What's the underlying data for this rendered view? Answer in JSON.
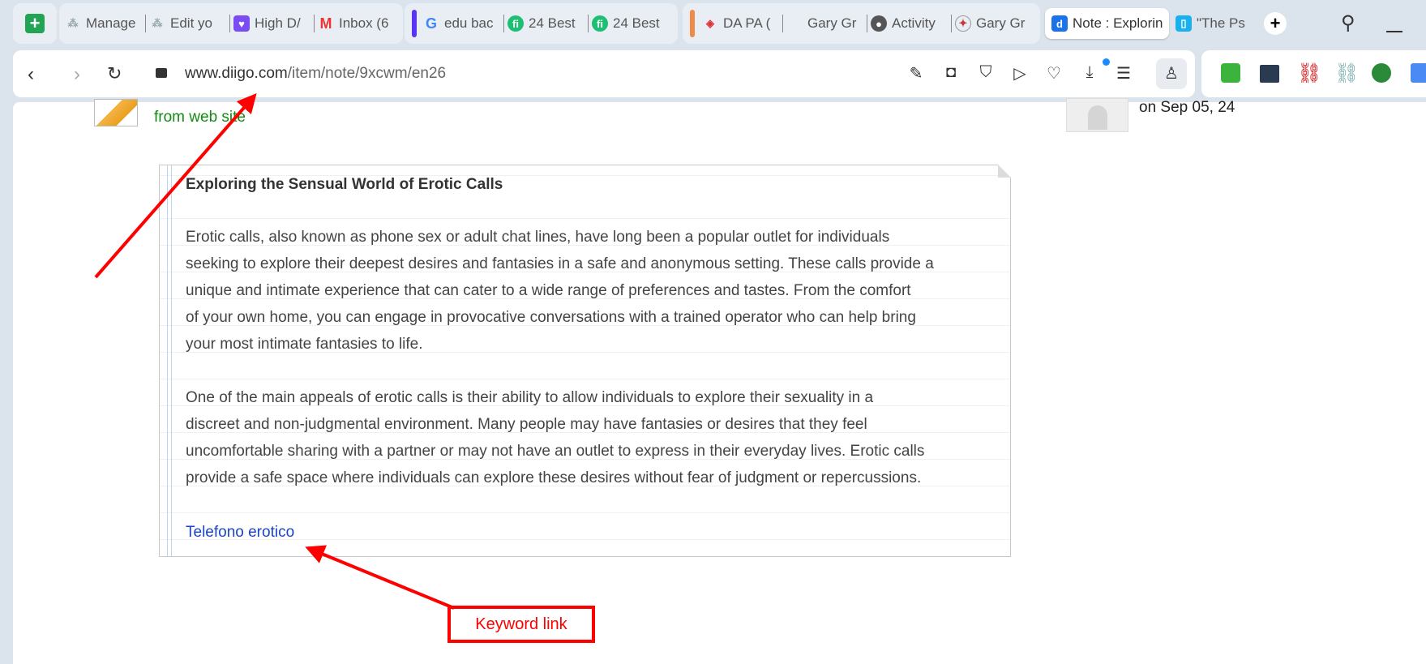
{
  "tabs": [
    {
      "label": "Manage",
      "icon": "network-icon"
    },
    {
      "label": "Edit yo",
      "icon": "network-icon"
    },
    {
      "label": "High D/",
      "icon": "heart-chat-icon"
    },
    {
      "label": "Inbox (6",
      "icon": "gmail-icon"
    },
    {
      "label": "edu bac",
      "icon": "google-icon"
    },
    {
      "label": "24 Best",
      "icon": "fiverr-icon"
    },
    {
      "label": "24 Best",
      "icon": "fiverr-icon"
    },
    {
      "label": "DA PA (",
      "icon": "diamond-icon"
    },
    {
      "label": "Gary Gr",
      "icon": "blank-icon"
    },
    {
      "label": "Activity",
      "icon": "globe-icon"
    },
    {
      "label": "Gary Gr",
      "icon": "seal-icon"
    },
    {
      "label": "Note : Explorin",
      "icon": "diigo-icon"
    },
    {
      "label": "\"The Ps",
      "icon": "page-icon"
    }
  ],
  "address": {
    "host": "www.diigo.com",
    "path": "/item/note/9xcwm/en26"
  },
  "source": "from web site",
  "date": "on Sep 05, 24",
  "note": {
    "title": "Exploring the Sensual World of Erotic Calls",
    "para1": [
      "Erotic calls, also known as phone sex or adult chat lines, have long been a popular outlet for individuals",
      "seeking to explore their deepest desires and fantasies in a safe and anonymous setting. These calls provide a",
      "unique and intimate experience that can cater to a wide range of preferences and tastes. From the comfort",
      "of your own home, you can engage in provocative conversations with a trained operator who can help bring",
      "your most intimate fantasies to life."
    ],
    "para2": [
      "One of the main appeals of erotic calls is their ability to allow individuals to explore their sexuality in a",
      "discreet and non-judgmental environment. Many people may have fantasies or desires that they feel",
      "uncomfortable sharing with a partner or may not have an outlet to express in their everyday lives. Erotic calls",
      "provide a safe space where individuals can explore these desires without fear of judgment or repercussions."
    ],
    "link": "Telefono erotico"
  },
  "annotation": "Keyword link",
  "colors": {
    "annotation": "#ff0000",
    "link": "#1a44c8",
    "source": "#138a13"
  }
}
